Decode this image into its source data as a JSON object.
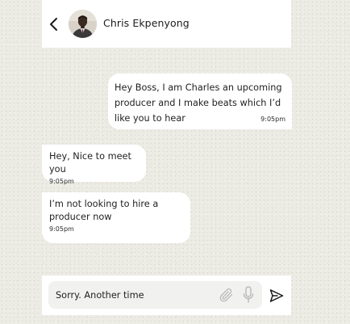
{
  "header": {
    "contact_name": "Chris Ekpenyong",
    "back_icon": "chevron-left-icon",
    "avatar": "contact-avatar-photo"
  },
  "messages": [
    {
      "direction": "outgoing",
      "text": "Hey Boss, I am Charles an upcoming producer and I make beats which I’d like you to hear",
      "time": "9:05pm"
    },
    {
      "direction": "incoming",
      "text": "Hey, Nice to meet you",
      "time": "9:05pm"
    },
    {
      "direction": "incoming",
      "text": "I’m not looking to hire a producer now",
      "time": "9:05pm"
    }
  ],
  "composer": {
    "input_value": "Sorry. Another time",
    "attach_icon": "paperclip-icon",
    "mic_icon": "microphone-icon",
    "send_icon": "send-icon"
  },
  "colors": {
    "background": "#ecebe4",
    "bubble": "#ffffff",
    "text": "#1f1f1f",
    "icon_muted": "#b9b9b9",
    "input_bg": "#f1f1ef"
  }
}
